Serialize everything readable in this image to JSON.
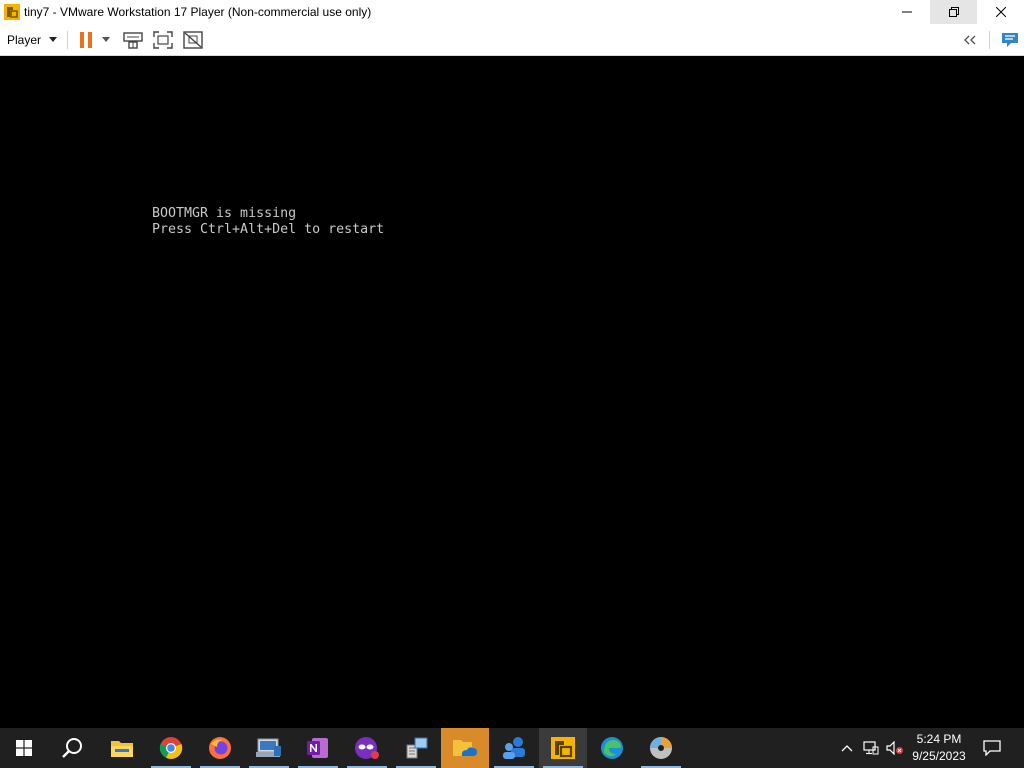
{
  "window": {
    "title": "tiny7 - VMware Workstation 17 Player (Non-commercial use only)",
    "app_icon": "vmware-player-icon",
    "controls": [
      "minimize-icon",
      "restore-icon",
      "close-icon"
    ]
  },
  "toolbar": {
    "player_menu_label": "Player",
    "buttons": [
      "pause-icon",
      "dropdown-caret-icon",
      "send-ctrl-alt-del-icon",
      "full-screen-icon",
      "unity-icon"
    ],
    "right_buttons": [
      "collapse-toolbar-icon",
      "vm-message-log-icon"
    ]
  },
  "vm_console": {
    "line1": "BOOTMGR is missing",
    "line2": "Press Ctrl+Alt+Del to restart",
    "text_color": "#c8c8c8",
    "background": "#000000"
  },
  "taskbar": {
    "background": "#202020",
    "apps": [
      "windows-start-icon",
      "search-icon",
      "file-explorer-icon",
      "chrome-icon",
      "firefox-icon",
      "remote-desktop-icon",
      "onenote-icon",
      "privacy-mask-icon",
      "network-tool-icon",
      "onedrive-folder-icon",
      "people-icon",
      "vmware-player-icon",
      "edge-icon",
      "media-disc-icon"
    ],
    "tray": {
      "chevron": "show-hidden-icons-icon",
      "network": "network-icon",
      "volume": "volume-muted-icon",
      "time": "5:24 PM",
      "date": "9/25/2023",
      "notifications": "action-center-icon"
    }
  }
}
